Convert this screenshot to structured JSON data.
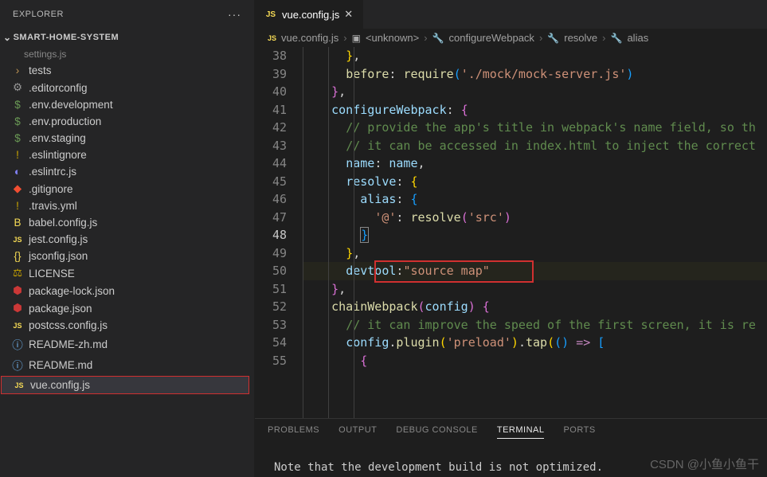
{
  "explorer": {
    "title": "EXPLORER",
    "project": "SMART-HOME-SYSTEM",
    "truncated": "settings.js",
    "items": [
      {
        "icon": "chevron",
        "label": "tests",
        "type": "folder"
      },
      {
        "icon": "gear",
        "label": ".editorconfig"
      },
      {
        "icon": "dollar",
        "label": ".env.development"
      },
      {
        "icon": "dollar",
        "label": ".env.production"
      },
      {
        "icon": "dollar",
        "label": ".env.staging"
      },
      {
        "icon": "warn",
        "label": ".eslintignore"
      },
      {
        "icon": "eslint",
        "label": ".eslintrc.js"
      },
      {
        "icon": "git",
        "label": ".gitignore"
      },
      {
        "icon": "warn",
        "label": ".travis.yml"
      },
      {
        "icon": "babel",
        "label": "babel.config.js"
      },
      {
        "icon": "js",
        "label": "jest.config.js"
      },
      {
        "icon": "brace",
        "label": "jsconfig.json"
      },
      {
        "icon": "license",
        "label": "LICENSE"
      },
      {
        "icon": "npm",
        "label": "package-lock.json"
      },
      {
        "icon": "npm",
        "label": "package.json"
      },
      {
        "icon": "js",
        "label": "postcss.config.js"
      },
      {
        "icon": "info",
        "label": "README-zh.md"
      },
      {
        "icon": "info",
        "label": "README.md"
      },
      {
        "icon": "js",
        "label": "vue.config.js",
        "selected": true
      }
    ]
  },
  "tabs": {
    "active": {
      "icon": "JS",
      "label": "vue.config.js"
    }
  },
  "breadcrumbs": [
    {
      "icon": "js",
      "label": "vue.config.js"
    },
    {
      "icon": "cube",
      "label": "<unknown>"
    },
    {
      "icon": "wrench",
      "label": "configureWebpack"
    },
    {
      "icon": "wrench",
      "label": "resolve"
    },
    {
      "icon": "wrench",
      "label": "alias"
    }
  ],
  "editor": {
    "lines": [
      {
        "n": 38,
        "indent": 3,
        "tokens": [
          {
            "t": "brace-y",
            "v": "}"
          },
          {
            "t": "punct",
            "v": ","
          }
        ]
      },
      {
        "n": 39,
        "indent": 3,
        "tokens": [
          {
            "t": "fn",
            "v": "before"
          },
          {
            "t": "punct",
            "v": ": "
          },
          {
            "t": "fn",
            "v": "require"
          },
          {
            "t": "brace-b",
            "v": "("
          },
          {
            "t": "str",
            "v": "'./mock/mock-server.js'"
          },
          {
            "t": "brace-b",
            "v": ")"
          }
        ]
      },
      {
        "n": 40,
        "indent": 2,
        "tokens": [
          {
            "t": "brace-p",
            "v": "}"
          },
          {
            "t": "punct",
            "v": ","
          }
        ]
      },
      {
        "n": 41,
        "indent": 2,
        "tokens": [
          {
            "t": "prop",
            "v": "configureWebpack"
          },
          {
            "t": "punct",
            "v": ": "
          },
          {
            "t": "brace-p",
            "v": "{"
          }
        ]
      },
      {
        "n": 42,
        "indent": 3,
        "tokens": [
          {
            "t": "comment",
            "v": "// provide the app's title in webpack's name field, so th"
          }
        ]
      },
      {
        "n": 43,
        "indent": 3,
        "tokens": [
          {
            "t": "comment",
            "v": "// it can be accessed in index.html to inject the correct"
          }
        ]
      },
      {
        "n": 44,
        "indent": 3,
        "tokens": [
          {
            "t": "prop",
            "v": "name"
          },
          {
            "t": "punct",
            "v": ": "
          },
          {
            "t": "var",
            "v": "name"
          },
          {
            "t": "punct",
            "v": ","
          }
        ]
      },
      {
        "n": 45,
        "indent": 3,
        "tokens": [
          {
            "t": "prop",
            "v": "resolve"
          },
          {
            "t": "punct",
            "v": ": "
          },
          {
            "t": "brace-y",
            "v": "{"
          }
        ]
      },
      {
        "n": 46,
        "indent": 4,
        "tokens": [
          {
            "t": "prop",
            "v": "alias"
          },
          {
            "t": "punct",
            "v": ": "
          },
          {
            "t": "brace-b",
            "v": "{"
          }
        ]
      },
      {
        "n": 47,
        "indent": 5,
        "tokens": [
          {
            "t": "str",
            "v": "'@'"
          },
          {
            "t": "punct",
            "v": ": "
          },
          {
            "t": "fn",
            "v": "resolve"
          },
          {
            "t": "brace-p",
            "v": "("
          },
          {
            "t": "str",
            "v": "'src'"
          },
          {
            "t": "brace-p",
            "v": ")"
          }
        ]
      },
      {
        "n": 48,
        "indent": 4,
        "active": true,
        "tokens": [
          {
            "t": "brace-b",
            "v": "}",
            "box": true
          }
        ]
      },
      {
        "n": 49,
        "indent": 3,
        "tokens": [
          {
            "t": "brace-y",
            "v": "}"
          },
          {
            "t": "punct",
            "v": ","
          }
        ]
      },
      {
        "n": 50,
        "indent": 3,
        "highlight": true,
        "tokens": [
          {
            "t": "prop",
            "v": "devtool"
          },
          {
            "t": "punct",
            "v": ":"
          },
          {
            "t": "str",
            "v": "\"source map\""
          }
        ]
      },
      {
        "n": 51,
        "indent": 2,
        "tokens": [
          {
            "t": "brace-p",
            "v": "}"
          },
          {
            "t": "punct",
            "v": ","
          }
        ]
      },
      {
        "n": 52,
        "indent": 2,
        "tokens": [
          {
            "t": "fn",
            "v": "chainWebpack"
          },
          {
            "t": "brace-p",
            "v": "("
          },
          {
            "t": "var",
            "v": "config"
          },
          {
            "t": "brace-p",
            "v": ")"
          },
          {
            "t": "punct",
            "v": " "
          },
          {
            "t": "brace-p",
            "v": "{"
          }
        ]
      },
      {
        "n": 53,
        "indent": 3,
        "tokens": [
          {
            "t": "comment",
            "v": "// it can improve the speed of the first screen, it is re"
          }
        ]
      },
      {
        "n": 54,
        "indent": 3,
        "tokens": [
          {
            "t": "var",
            "v": "config"
          },
          {
            "t": "punct",
            "v": "."
          },
          {
            "t": "fn",
            "v": "plugin"
          },
          {
            "t": "brace-y",
            "v": "("
          },
          {
            "t": "str",
            "v": "'preload'"
          },
          {
            "t": "brace-y",
            "v": ")"
          },
          {
            "t": "punct",
            "v": "."
          },
          {
            "t": "fn",
            "v": "tap"
          },
          {
            "t": "brace-y",
            "v": "("
          },
          {
            "t": "brace-b",
            "v": "("
          },
          {
            "t": "brace-b",
            "v": ")"
          },
          {
            "t": "punct",
            "v": " "
          },
          {
            "t": "keyword",
            "v": "=>"
          },
          {
            "t": "punct",
            "v": " "
          },
          {
            "t": "brace-b",
            "v": "["
          }
        ]
      },
      {
        "n": 55,
        "indent": 4,
        "tokens": [
          {
            "t": "brace-p",
            "v": "{"
          }
        ]
      }
    ]
  },
  "panel": {
    "tabs": [
      "PROBLEMS",
      "OUTPUT",
      "DEBUG CONSOLE",
      "TERMINAL",
      "PORTS"
    ],
    "active": "TERMINAL",
    "terminal_text": "Note that the development build is not optimized."
  },
  "watermark": "CSDN @小鱼小鱼干"
}
